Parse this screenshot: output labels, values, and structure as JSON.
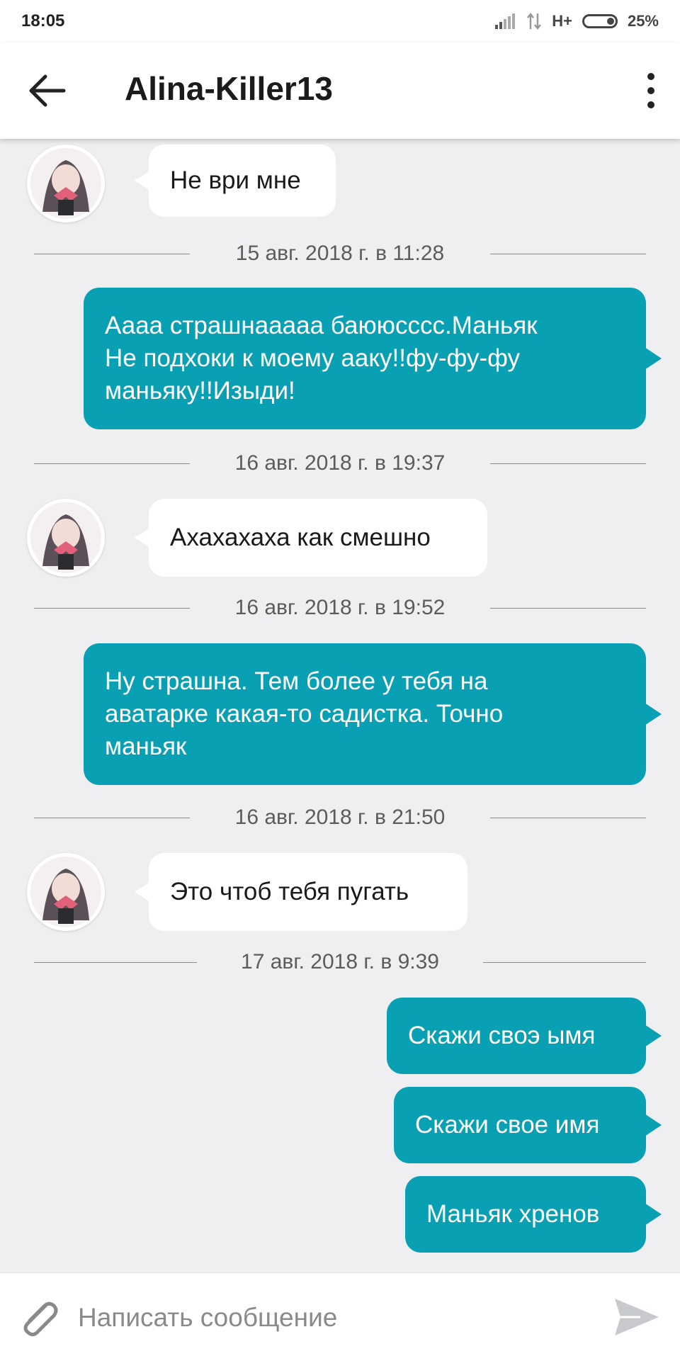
{
  "status_bar": {
    "time": "18:05",
    "network": "H+",
    "battery": "25%"
  },
  "header": {
    "title": "Alina-Killer13"
  },
  "messages": [
    {
      "type": "incoming",
      "text": "Не ври мне"
    },
    {
      "type": "date",
      "text": "15 авг. 2018 г. в 11:28"
    },
    {
      "type": "outgoing",
      "lines": [
        "Аааа страшнааааа баююсссс.Маньяк",
        "Не подхоки к моему ааку!!фу-фу-фу",
        "маньяку!!Изыди!"
      ]
    },
    {
      "type": "date",
      "text": "16 авг. 2018 г. в 19:37"
    },
    {
      "type": "incoming",
      "text": "Ахахахаха как смешно"
    },
    {
      "type": "date",
      "text": "16 авг. 2018 г. в 19:52"
    },
    {
      "type": "outgoing",
      "lines": [
        "Ну страшна. Тем более у тебя на",
        "аватарке какая-то садистка. Точно",
        "маньяк"
      ]
    },
    {
      "type": "date",
      "text": "16 авг. 2018 г. в 21:50"
    },
    {
      "type": "incoming",
      "text": "Это чтоб тебя пугать"
    },
    {
      "type": "date",
      "text": "17 авг. 2018 г. в 9:39"
    },
    {
      "type": "outgoing",
      "text": "Скажи своэ ымя"
    },
    {
      "type": "outgoing",
      "text": "Скажи свое имя"
    },
    {
      "type": "outgoing",
      "text": "Маньяк хренов"
    }
  ],
  "composer": {
    "placeholder": "Написать сообщение"
  },
  "colors": {
    "outgoing_bubble": "#0aa0b4",
    "incoming_bubble": "#ffffff",
    "background": "#efeff1"
  }
}
